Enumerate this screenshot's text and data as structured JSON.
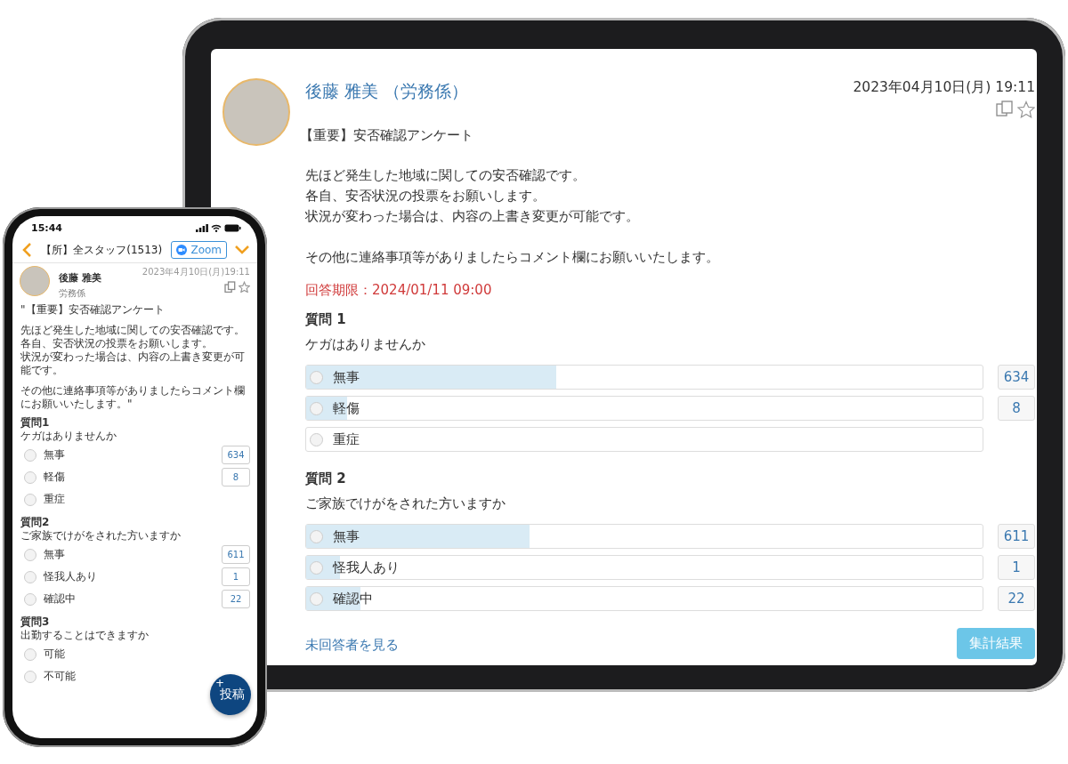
{
  "tablet": {
    "author": "後藤 雅美 （労務係）",
    "date": "2023年04月10日(月) 19:11",
    "subject": "【重要】安否確認アンケート",
    "body": [
      [
        "先ほど発生した地域に関しての安否確認です。",
        "各自、安否状況の投票をお願いします。",
        "状況が変わった場合は、内容の上書き変更が可能です。"
      ],
      [
        "その他に連絡事項等がありましたらコメント欄にお願いいたします。"
      ]
    ],
    "deadline": "回答期限：2024/01/11 09:00",
    "questions": [
      {
        "label": "質問 1",
        "text": "ケガはありませんか",
        "options": [
          {
            "label": "無事",
            "selected": false,
            "level": 0.37,
            "count": "634"
          },
          {
            "label": "軽傷",
            "selected": false,
            "level": 0.06,
            "count": "8"
          },
          {
            "label": "重症",
            "selected": false,
            "level": 0
          }
        ]
      },
      {
        "label": "質問 2",
        "text": "ご家族でけがをされた方いますか",
        "options": [
          {
            "label": "無事",
            "selected": false,
            "level": 0.33,
            "count": "611"
          },
          {
            "label": "怪我人あり",
            "selected": false,
            "level": 0.05,
            "count": "1"
          },
          {
            "label": "確認中",
            "selected": false,
            "level": 0.08,
            "count": "22"
          }
        ]
      }
    ],
    "link": "未回答者を見る",
    "button": "集計結果"
  },
  "phone": {
    "time": "15:44",
    "title": "【所】全スタッフ(1513)",
    "zoom": "Zoom",
    "author": "後藤 雅美",
    "role": "労務係",
    "date": "2023年4月10日(月)19:11",
    "body": [
      [
        "\"【重要】安否確認アンケート"
      ],
      [
        "先ほど発生した地域に関しての安否確認です。",
        "各自、安否状況の投票をお願いします。",
        "状況が変わった場合は、内容の上書き変更が可能です。"
      ],
      [
        "その他に連絡事項等がありましたらコメント欄にお願いいたします。\""
      ]
    ],
    "questions": [
      {
        "label": "質問1",
        "text": "ケガはありませんか",
        "options": [
          {
            "label": "無事",
            "selected": false,
            "count": "634"
          },
          {
            "label": "軽傷",
            "selected": false,
            "count": "8"
          },
          {
            "label": "重症",
            "selected": false
          }
        ]
      },
      {
        "label": "質問2",
        "text": "ご家族でけがをされた方いますか",
        "options": [
          {
            "label": "無事",
            "selected": false,
            "count": "611"
          },
          {
            "label": "怪我人あり",
            "selected": false,
            "count": "1"
          },
          {
            "label": "確認中",
            "selected": false,
            "count": "22"
          }
        ]
      },
      {
        "label": "質問3",
        "text": "出勤することはできますか",
        "options": [
          {
            "label": "可能",
            "selected": false
          },
          {
            "label": "不可能",
            "selected": false
          }
        ]
      }
    ],
    "fab": {
      "plus": "+",
      "label": "投稿"
    }
  }
}
